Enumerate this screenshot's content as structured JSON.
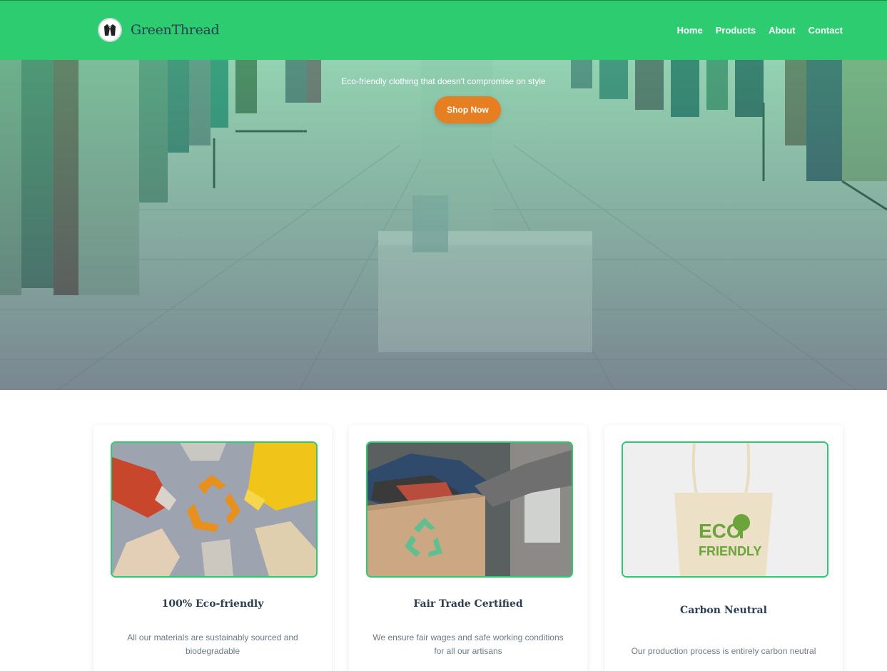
{
  "header": {
    "brand": "GreenThread",
    "nav": [
      "Home",
      "Products",
      "About",
      "Contact"
    ]
  },
  "hero": {
    "tagline": "Eco-friendly clothing that doesn't compromise on style",
    "cta": "Shop Now"
  },
  "features": [
    {
      "title": "100% Eco-friendly",
      "text": "All our materials are sustainably sourced and biodegradable"
    },
    {
      "title": "Fair Trade Certified",
      "text": "We ensure fair wages and safe working conditions for all our artisans"
    },
    {
      "title": "Carbon Neutral",
      "text": "Our production process is entirely carbon neutral"
    }
  ],
  "tote_print": [
    "ECO",
    "FRIENDLY"
  ],
  "colors": {
    "brand_green": "#2ecc71",
    "accent_orange": "#e67e22",
    "text_dark": "#2c3e50"
  }
}
